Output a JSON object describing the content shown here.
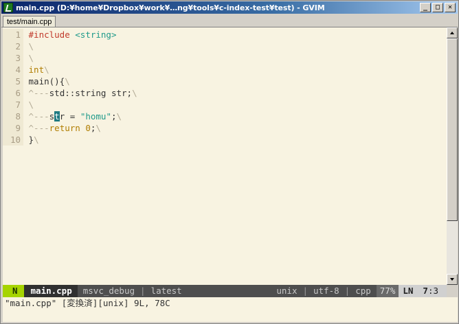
{
  "window": {
    "title": "main.cpp (D:¥home¥Dropbox¥work¥…ng¥tools¥c-index-test¥test) - GVIM",
    "buttons": {
      "minimize": "_",
      "maximize": "□",
      "close": "✕"
    }
  },
  "tabline": {
    "tabs": [
      {
        "label": "test/main.cpp"
      }
    ]
  },
  "editor": {
    "lines": [
      {
        "num": "1",
        "parts": [
          {
            "t": "#include",
            "c": "kw-preproc"
          },
          {
            "t": " ",
            "c": "code"
          },
          {
            "t": "<string>",
            "c": "str-inc"
          }
        ]
      },
      {
        "num": "2",
        "parts": [
          {
            "t": "\\",
            "c": "listchar"
          }
        ]
      },
      {
        "num": "3",
        "parts": [
          {
            "t": "\\",
            "c": "listchar"
          }
        ]
      },
      {
        "num": "4",
        "parts": [
          {
            "t": "int",
            "c": "type"
          },
          {
            "t": "\\",
            "c": "listchar"
          }
        ]
      },
      {
        "num": "5",
        "parts": [
          {
            "t": "main(){",
            "c": "code"
          },
          {
            "t": "\\",
            "c": "listchar"
          }
        ]
      },
      {
        "num": "6",
        "parts": [
          {
            "t": "^---",
            "c": "listchar"
          },
          {
            "t": "std::string str;",
            "c": "code"
          },
          {
            "t": "\\",
            "c": "listchar"
          }
        ]
      },
      {
        "num": "7",
        "parts": [
          {
            "t": "\\",
            "c": "listchar"
          }
        ]
      },
      {
        "num": "8",
        "parts": [
          {
            "t": "^---",
            "c": "listchar"
          },
          {
            "t": "s",
            "c": "code"
          },
          {
            "t": "t",
            "c": "cursor"
          },
          {
            "t": "r = ",
            "c": "code"
          },
          {
            "t": "\"homu\"",
            "c": "string"
          },
          {
            "t": ";",
            "c": "code"
          },
          {
            "t": "\\",
            "c": "listchar"
          }
        ]
      },
      {
        "num": "9",
        "parts": [
          {
            "t": "^---",
            "c": "listchar"
          },
          {
            "t": "return",
            "c": "kw"
          },
          {
            "t": " ",
            "c": "code"
          },
          {
            "t": "0",
            "c": "num"
          },
          {
            "t": ";",
            "c": "code"
          },
          {
            "t": "\\",
            "c": "listchar"
          }
        ]
      },
      {
        "num": "10",
        "parts": [
          {
            "t": "}",
            "c": "code"
          },
          {
            "t": "\\",
            "c": "listchar"
          }
        ]
      }
    ]
  },
  "statusline": {
    "mode": "N",
    "filename": "main.cpp",
    "build": "msvc_debug",
    "tag": "latest",
    "format": "unix",
    "encoding": "utf-8",
    "filetype": "cpp",
    "percent": "77%",
    "ln_label": "LN",
    "line": "7",
    "col": ":3"
  },
  "cmdline": {
    "message": "\"main.cpp\" [変換済][unix] 9L, 78C"
  }
}
